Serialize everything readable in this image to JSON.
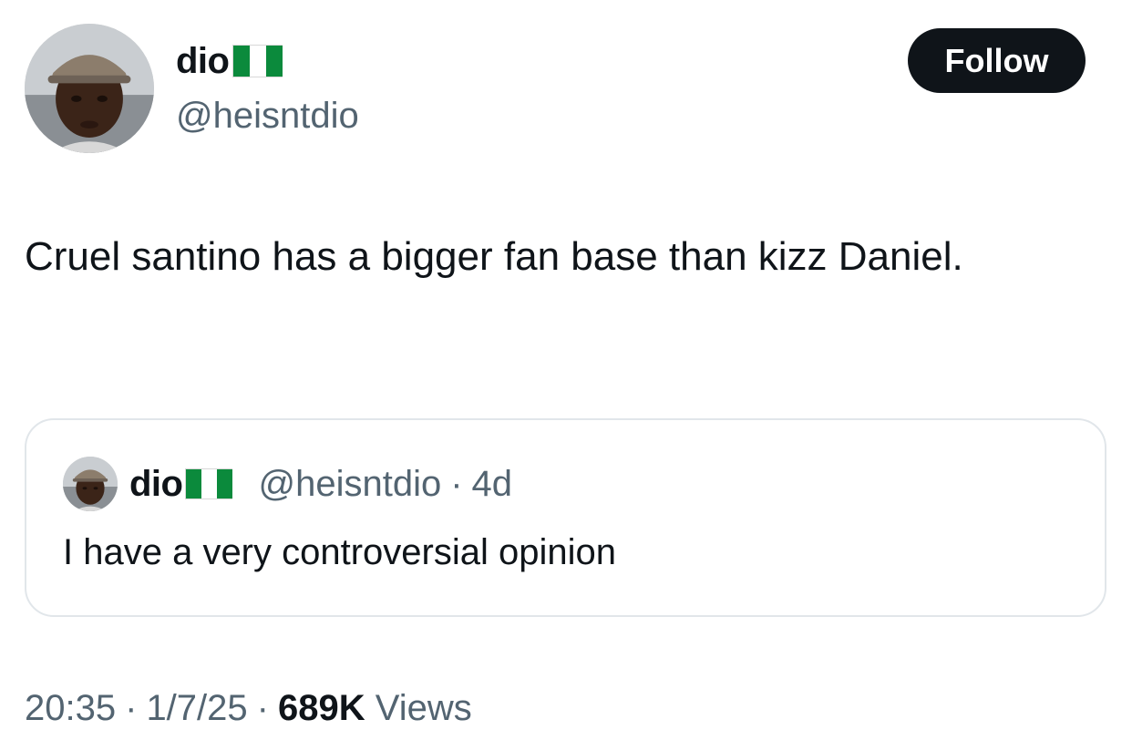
{
  "author": {
    "display_name": "dio",
    "flag_icon": "nigeria-flag-icon",
    "handle": "@heisntdio"
  },
  "follow_label": "Follow",
  "tweet_text": "Cruel santino has a bigger fan base than kizz Daniel.",
  "quoted": {
    "display_name": "dio",
    "flag_icon": "nigeria-flag-icon",
    "handle": "@heisntdio",
    "separator": "·",
    "time": "4d",
    "text": "I have a very controversial opinion"
  },
  "meta": {
    "time": "20:35",
    "date": "1/7/25",
    "views_count": "689K",
    "views_label": "Views",
    "separator": "·"
  },
  "colors": {
    "text": "#0f1419",
    "secondary": "#536471",
    "button_bg": "#0f1419",
    "border": "#e1e6ea",
    "flag_green": "#0b8a3c"
  }
}
